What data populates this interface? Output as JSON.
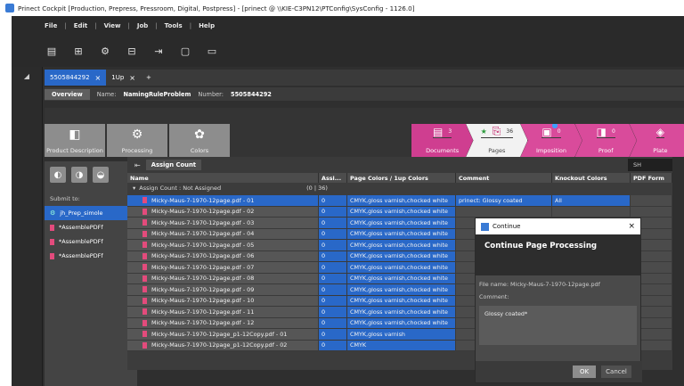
{
  "window": {
    "title": "Prinect Cockpit [Production, Prepress, Pressroom, Digital, Postpress] - [prinect @ \\\\KIE-C3PN12\\PTConfig\\SysConfig - 1126.0]"
  },
  "menu": [
    "File",
    "Edit",
    "View",
    "Job",
    "Tools",
    "Help"
  ],
  "tabs": [
    {
      "label": "5505844292",
      "close": "×"
    },
    {
      "label": "1Up",
      "close": "×"
    },
    {
      "label": "+"
    }
  ],
  "subheader": {
    "overview": "Overview",
    "name_label": "Name:",
    "name_value": "NamingRuleProblem",
    "number_label": "Number:",
    "number_value": "5505844292"
  },
  "nav": {
    "product_description": "Product Description",
    "processing": "Processing",
    "colors": "Colors"
  },
  "workflow": [
    {
      "label": "Documents",
      "count": "3"
    },
    {
      "label": "Pages",
      "count": "36"
    },
    {
      "label": "Imposition",
      "count": "0"
    },
    {
      "label": "Proof",
      "count": "0"
    },
    {
      "label": "Plate"
    }
  ],
  "left_panel": {
    "submit_to": "Submit to:",
    "items": [
      "jh_Prep_simole",
      "*AssemblePDFf",
      "*AssemblePDFf",
      "*AssemblePDFf"
    ]
  },
  "grid": {
    "assign_button": "Assign Count",
    "sh_value": "SH",
    "columns": [
      "Name",
      "Assi...",
      "Page Colors / 1up Colors",
      "Comment",
      "Knockout Colors",
      "PDF Form"
    ],
    "group": {
      "label": "Assign Count : Not Assigned",
      "count": "(0 | 36)"
    },
    "rows": [
      {
        "name": "Micky-Maus-7-1970-12page.pdf - 01",
        "assi": "0",
        "colors": "CMYK,gloss varnish,chocked white",
        "comment": "prinect: Glossy coated",
        "knock": "All"
      },
      {
        "name": "Micky-Maus-7-1970-12page.pdf - 02",
        "assi": "0",
        "colors": "CMYK,gloss varnish,chocked white",
        "comment": "",
        "knock": ""
      },
      {
        "name": "Micky-Maus-7-1970-12page.pdf - 03",
        "assi": "0",
        "colors": "CMYK,gloss varnish,chocked white",
        "comment": "",
        "knock": ""
      },
      {
        "name": "Micky-Maus-7-1970-12page.pdf - 04",
        "assi": "0",
        "colors": "CMYK,gloss varnish,chocked white",
        "comment": "",
        "knock": ""
      },
      {
        "name": "Micky-Maus-7-1970-12page.pdf - 05",
        "assi": "0",
        "colors": "CMYK,gloss varnish,chocked white",
        "comment": "",
        "knock": ""
      },
      {
        "name": "Micky-Maus-7-1970-12page.pdf - 06",
        "assi": "0",
        "colors": "CMYK,gloss varnish,chocked white",
        "comment": "",
        "knock": ""
      },
      {
        "name": "Micky-Maus-7-1970-12page.pdf - 07",
        "assi": "0",
        "colors": "CMYK,gloss varnish,chocked white",
        "comment": "",
        "knock": ""
      },
      {
        "name": "Micky-Maus-7-1970-12page.pdf - 08",
        "assi": "0",
        "colors": "CMYK,gloss varnish,chocked white",
        "comment": "",
        "knock": ""
      },
      {
        "name": "Micky-Maus-7-1970-12page.pdf - 09",
        "assi": "0",
        "colors": "CMYK,gloss varnish,chocked white",
        "comment": "",
        "knock": ""
      },
      {
        "name": "Micky-Maus-7-1970-12page.pdf - 10",
        "assi": "0",
        "colors": "CMYK,gloss varnish,chocked white",
        "comment": "",
        "knock": ""
      },
      {
        "name": "Micky-Maus-7-1970-12page.pdf - 11",
        "assi": "0",
        "colors": "CMYK,gloss varnish,chocked white",
        "comment": "",
        "knock": ""
      },
      {
        "name": "Micky-Maus-7-1970-12page.pdf - 12",
        "assi": "0",
        "colors": "CMYK,gloss varnish,chocked white",
        "comment": "",
        "knock": ""
      },
      {
        "name": "Micky-Maus-7-1970-12page_p1-12Copy.pdf - 01",
        "assi": "0",
        "colors": "CMYK,gloss varnish",
        "comment": "",
        "knock": ""
      },
      {
        "name": "Micky-Maus-7-1970-12page_p1-12Copy.pdf - 02",
        "assi": "0",
        "colors": "CMYK",
        "comment": "",
        "knock": ""
      }
    ]
  },
  "dialog": {
    "title": "Continue",
    "close": "×",
    "heading": "Continue Page Processing",
    "file_name": "File name: Micky-Maus-7-1970-12page.pdf",
    "comment_label": "Comment:",
    "comment_value": "Glossy coated*",
    "ok": "OK",
    "cancel": "Cancel"
  },
  "colors": {
    "accent": "#2968c8",
    "workflow_pink": "#d94b9b",
    "background": "#2f2f2f"
  }
}
